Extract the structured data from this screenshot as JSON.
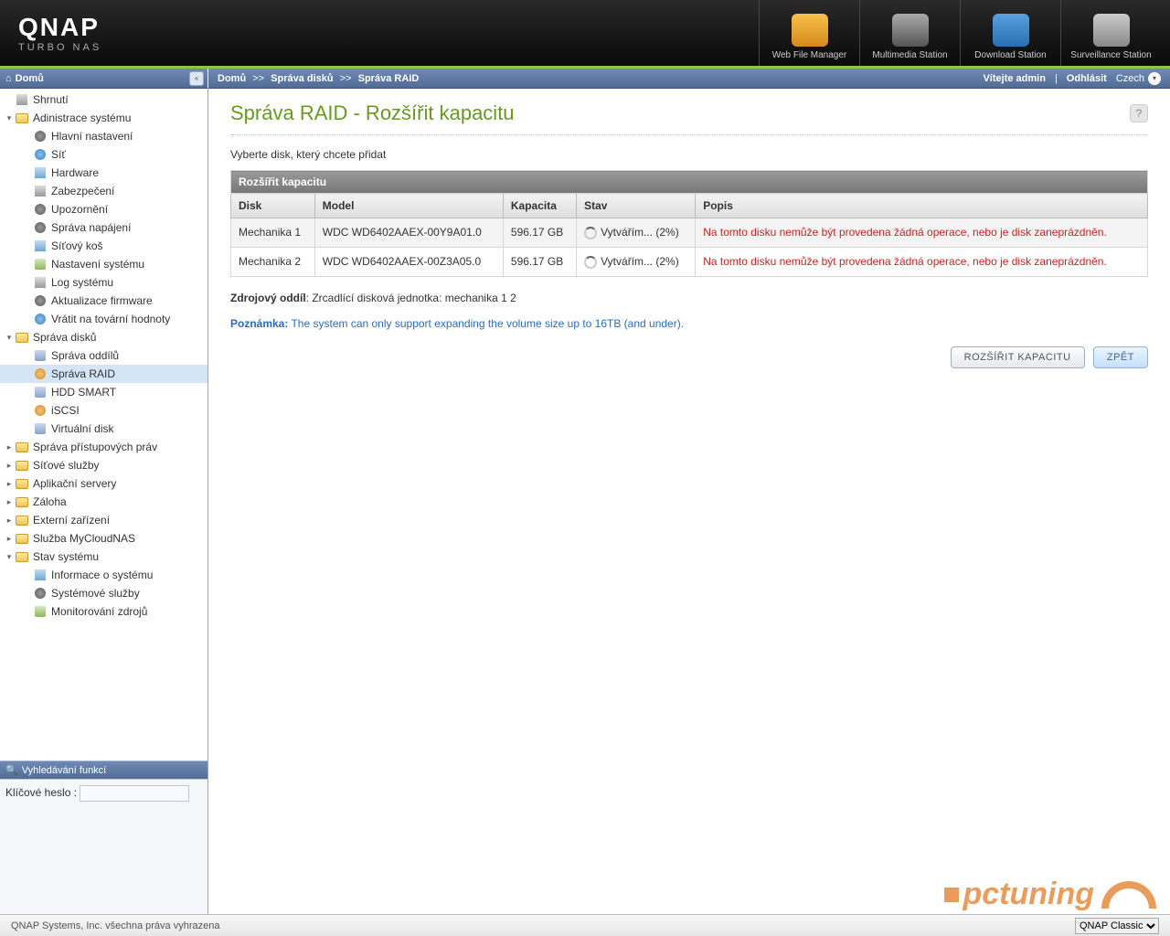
{
  "brand": {
    "name": "QNAP",
    "sub": "TURBO NAS"
  },
  "shortcuts": [
    {
      "label": "Web File Manager",
      "icon": "ic-folder"
    },
    {
      "label": "Multimedia Station",
      "icon": "ic-mm"
    },
    {
      "label": "Download Station",
      "icon": "ic-dl"
    },
    {
      "label": "Surveillance Station",
      "icon": "ic-sv"
    }
  ],
  "sidebar": {
    "home": "Domů",
    "search_header": "Vyhledávání funkcí",
    "search_label": "Klíčové heslo :",
    "tree": [
      {
        "label": "Shrnutí",
        "depth": 0,
        "icon": "pg-ic",
        "exp": ""
      },
      {
        "label": "Adinistrace systému",
        "depth": 0,
        "icon": "folder-open",
        "exp": "▾"
      },
      {
        "label": "Hlavní nastavení",
        "depth": 1,
        "icon": "gear-ic"
      },
      {
        "label": "Síť",
        "depth": 1,
        "icon": "net-ic"
      },
      {
        "label": "Hardware",
        "depth": 1,
        "icon": "hw-ic"
      },
      {
        "label": "Zabezpečení",
        "depth": 1,
        "icon": "pg-ic"
      },
      {
        "label": "Upozornění",
        "depth": 1,
        "icon": "gear-ic"
      },
      {
        "label": "Správa napájení",
        "depth": 1,
        "icon": "gear-ic"
      },
      {
        "label": "Síťový koš",
        "depth": 1,
        "icon": "hw-ic"
      },
      {
        "label": "Nastavení systému",
        "depth": 1,
        "icon": "sys-ic"
      },
      {
        "label": "Log systému",
        "depth": 1,
        "icon": "pg-ic"
      },
      {
        "label": "Aktualizace firmware",
        "depth": 1,
        "icon": "gear-ic"
      },
      {
        "label": "Vrátit na tovární hodnoty",
        "depth": 1,
        "icon": "net-ic"
      },
      {
        "label": "Správa disků",
        "depth": 0,
        "icon": "folder-open",
        "exp": "▾"
      },
      {
        "label": "Správa oddílů",
        "depth": 1,
        "icon": "disk-ic"
      },
      {
        "label": "Správa RAID",
        "depth": 1,
        "icon": "raid-ic",
        "active": true
      },
      {
        "label": "HDD SMART",
        "depth": 1,
        "icon": "disk-ic"
      },
      {
        "label": "iSCSI",
        "depth": 1,
        "icon": "raid-ic"
      },
      {
        "label": "Virtuální disk",
        "depth": 1,
        "icon": "disk-ic"
      },
      {
        "label": "Správa přístupových práv",
        "depth": 0,
        "icon": "folder-closed",
        "exp": "▸"
      },
      {
        "label": "Síťové služby",
        "depth": 0,
        "icon": "folder-closed",
        "exp": "▸"
      },
      {
        "label": "Aplikační servery",
        "depth": 0,
        "icon": "folder-closed",
        "exp": "▸"
      },
      {
        "label": "Záloha",
        "depth": 0,
        "icon": "folder-closed",
        "exp": "▸"
      },
      {
        "label": "Externí zařízení",
        "depth": 0,
        "icon": "folder-closed",
        "exp": "▸"
      },
      {
        "label": "Služba MyCloudNAS",
        "depth": 0,
        "icon": "folder-closed",
        "exp": "▸"
      },
      {
        "label": "Stav systému",
        "depth": 0,
        "icon": "folder-open",
        "exp": "▾"
      },
      {
        "label": "Informace o systému",
        "depth": 1,
        "icon": "hw-ic"
      },
      {
        "label": "Systémové služby",
        "depth": 1,
        "icon": "gear-ic"
      },
      {
        "label": "Monitorování zdrojů",
        "depth": 1,
        "icon": "sys-ic"
      }
    ]
  },
  "breadcrumb": [
    "Domů",
    "Správa disků",
    "Správa RAID"
  ],
  "user_bar": {
    "welcome": "Vítejte admin",
    "sep": "|",
    "logout": "Odhlásit",
    "lang": "Czech"
  },
  "page": {
    "title": "Správa RAID - Rozšířit kapacitu",
    "subtitle": "Vyberte disk, který chcete přidat",
    "table": {
      "caption": "Rozšířit kapacitu",
      "cols": [
        "Disk",
        "Model",
        "Kapacita",
        "Stav",
        "Popis"
      ],
      "rows": [
        {
          "disk": "Mechanika 1",
          "model": "WDC WD6402AAEX-00Y9A01.0",
          "cap": "596.17 GB",
          "status": "Vytvářím... (2%)",
          "desc": "Na tomto disku nemůže být provedena žádná operace, nebo je disk zaneprázdněn."
        },
        {
          "disk": "Mechanika 2",
          "model": "WDC WD6402AAEX-00Z3A05.0",
          "cap": "596.17 GB",
          "status": "Vytvářím... (2%)",
          "desc": "Na tomto disku nemůže být provedena žádná operace, nebo je disk zaneprázdněn."
        }
      ]
    },
    "source_label": "Zdrojový oddíl",
    "source_value": ": Zrcadlící disková jednotka: mechanika 1 2",
    "note_label": "Poznámka:",
    "note_text": " The system can only support expanding the volume size up to 16TB (and under).",
    "btn_expand": "ROZŠÍŘIT KAPACITU",
    "btn_back": "ZPĚT"
  },
  "footer": {
    "copyright": "QNAP Systems, Inc. všechna práva vyhrazena",
    "theme_label": "QNAP Classic"
  },
  "watermark": "pctuning"
}
